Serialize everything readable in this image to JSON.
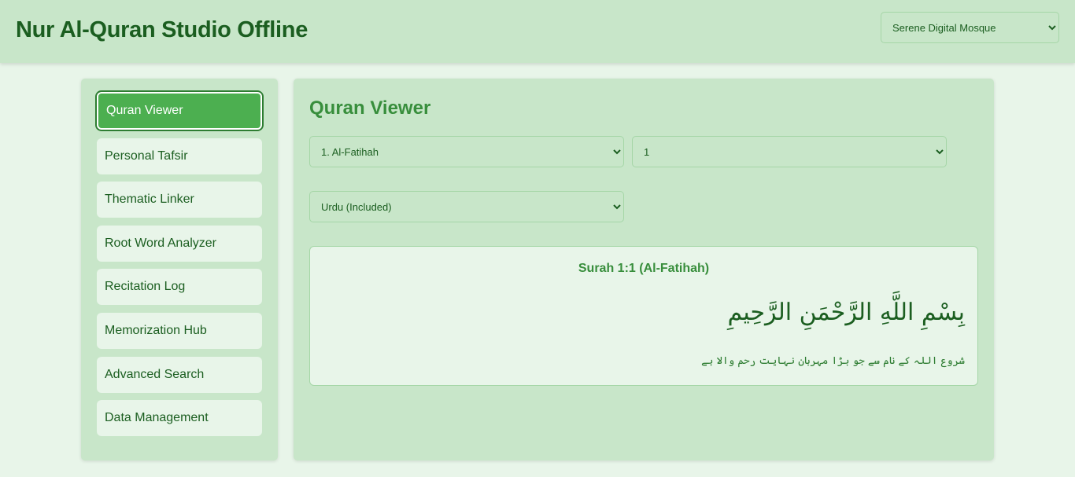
{
  "header": {
    "title": "Nur Al-Quran Studio Offline",
    "theme": {
      "selected": "Serene Digital Mosque",
      "options": [
        "Serene Digital Mosque"
      ]
    }
  },
  "sidebar": {
    "items": [
      {
        "label": "Quran Viewer",
        "active": true
      },
      {
        "label": "Personal Tafsir",
        "active": false
      },
      {
        "label": "Thematic Linker",
        "active": false
      },
      {
        "label": "Root Word Analyzer",
        "active": false
      },
      {
        "label": "Recitation Log",
        "active": false
      },
      {
        "label": "Memorization Hub",
        "active": false
      },
      {
        "label": "Advanced Search",
        "active": false
      },
      {
        "label": "Data Management",
        "active": false
      }
    ]
  },
  "main": {
    "title": "Quran Viewer",
    "surah_select": {
      "selected": "1. Al-Fatihah",
      "options": [
        "1. Al-Fatihah"
      ]
    },
    "ayah_select": {
      "selected": "1",
      "options": [
        "1"
      ]
    },
    "translation_select": {
      "selected": "Urdu (Included)",
      "options": [
        "Urdu (Included)"
      ]
    },
    "verse": {
      "reference": "Surah 1:1 (Al-Fatihah)",
      "arabic": "بِسْمِ اللَّهِ الرَّحْمَنِ الرَّحِيمِ",
      "translation": "شروع اللہ کے نام سے جو بڑا مہربان نہایت رحم والا ہے"
    }
  },
  "colors": {
    "background": "#e8f5e9",
    "panel": "#c8e6c9",
    "accent": "#4caf50",
    "heading": "#1b5e20",
    "subheading": "#388e3c"
  }
}
